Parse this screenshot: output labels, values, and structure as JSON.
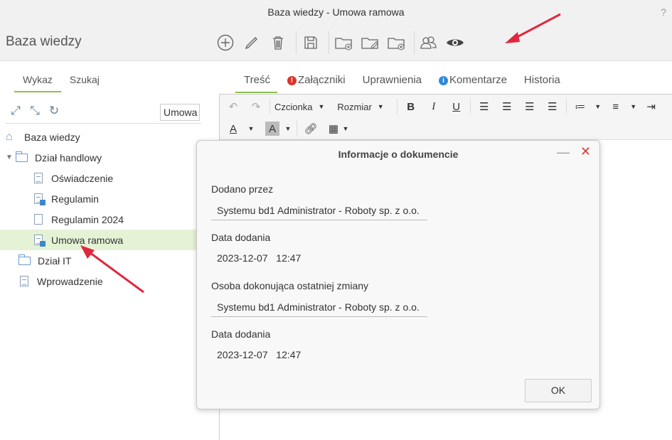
{
  "window": {
    "title": "Baza wiedzy - Umowa ramowa",
    "help": "?"
  },
  "left": {
    "header": "Baza wiedzy",
    "tabs": [
      {
        "label": "Wykaz"
      },
      {
        "label": "Szukaj"
      }
    ],
    "filter_value": "Umowa",
    "tree": [
      {
        "label": "Baza wiedzy"
      },
      {
        "label": "Dział handlowy"
      },
      {
        "label": "Oświadczenie"
      },
      {
        "label": "Regulamin"
      },
      {
        "label": "Regulamin 2024"
      },
      {
        "label": "Umowa ramowa"
      },
      {
        "label": "Dział IT"
      },
      {
        "label": "Wprowadzenie"
      }
    ]
  },
  "doc_tabs": [
    {
      "label": "Treść"
    },
    {
      "label": "Załączniki"
    },
    {
      "label": "Uprawnienia"
    },
    {
      "label": "Komentarze"
    },
    {
      "label": "Historia"
    }
  ],
  "editor": {
    "font_label": "Czcionka",
    "size_label": "Rozmiar"
  },
  "dialog": {
    "title": "Informacje o dokumencie",
    "fields": [
      {
        "label": "Dodano przez",
        "value": "Systemu bd1 Administrator - Roboty sp. z o.o."
      },
      {
        "label": "Data dodania",
        "value": "2023-12-07   12:47"
      },
      {
        "label": "Osoba dokonująca ostatniej zmiany",
        "value": "Systemu bd1 Administrator - Roboty sp. z o.o."
      },
      {
        "label": "Data dodania",
        "value": "2023-12-07   12:47"
      }
    ],
    "ok_label": "OK"
  },
  "colors": {
    "accent": "#8cc04b",
    "selection": "#e4f2d6",
    "arrow": "#e0283c",
    "close": "#d93a3a"
  }
}
